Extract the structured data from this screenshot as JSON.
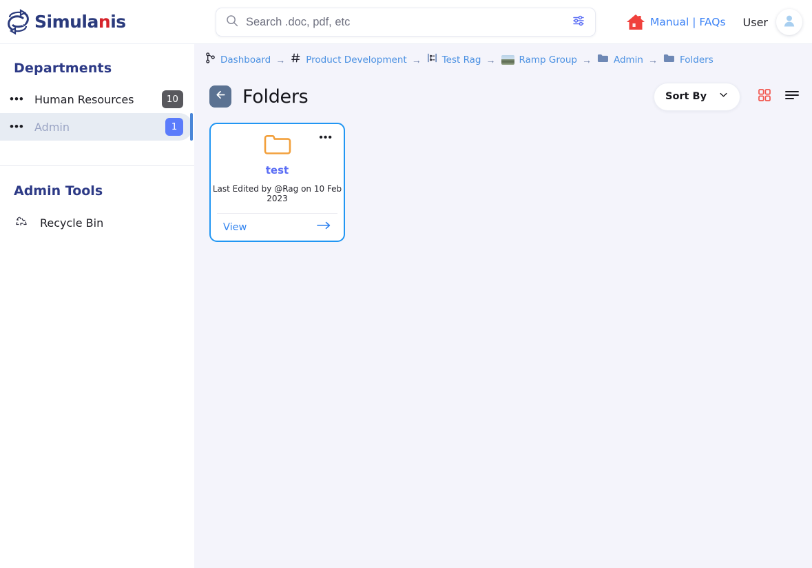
{
  "brand": {
    "name_prefix": "Simula",
    "name_accent": "n",
    "name_suffix": "is",
    "logo_icon": "simulanis-s-logo-icon",
    "primary_color": "#2a3a7c",
    "accent_color": "#d6232b"
  },
  "search": {
    "placeholder": "Search .doc, pdf, etc",
    "value": "",
    "search_icon": "search-icon",
    "filter_icon": "filter-sliders-icon"
  },
  "header": {
    "home_icon": "home-icon",
    "manual_label": "Manual",
    "separator": "|",
    "faqs_label": "FAQs",
    "user_label": "User",
    "avatar_icon": "user-avatar-icon",
    "link_color": "#3b82f6"
  },
  "sidebar": {
    "departments_title": "Departments",
    "departments": [
      {
        "label": "Human Resources",
        "badge": "10",
        "badge_color": "#58585d",
        "active": false,
        "menu_icon": "more-dots-icon"
      },
      {
        "label": "Admin",
        "badge": "1",
        "badge_color": "#5b7cfb",
        "active": true,
        "menu_icon": "more-dots-icon"
      }
    ],
    "tools_title": "Admin Tools",
    "tools": [
      {
        "label": "Recycle Bin",
        "icon": "recycle-bin-icon"
      }
    ]
  },
  "breadcrumb": {
    "arrow": "→",
    "items": [
      {
        "label": "Dashboard",
        "icon": "git-branch-icon"
      },
      {
        "label": "Product Development",
        "icon": "hash-icon"
      },
      {
        "label": "Test Rag",
        "icon": "list-tree-icon"
      },
      {
        "label": "Ramp Group",
        "icon": "image-thumbnail-icon"
      },
      {
        "label": "Admin",
        "icon": "folder-filled-icon"
      },
      {
        "label": "Folders",
        "icon": "folder-filled-icon"
      }
    ]
  },
  "page": {
    "back_icon": "back-arrow-icon",
    "title": "Folders",
    "sort_label": "Sort By",
    "sort_chevron_icon": "chevron-down-icon",
    "grid_view_icon": "grid-view-icon",
    "list_view_icon": "list-view-icon",
    "grid_view_color": "#f2554d"
  },
  "folders": [
    {
      "folder_icon": "folder-outline-icon",
      "menu_icon": "more-dots-icon",
      "name": "test",
      "meta": "Last Edited by @Rag on 10 Feb 2023",
      "action_label": "View",
      "action_icon": "arrow-right-icon",
      "border_color": "#2196f3",
      "icon_color": "#f2a03c"
    }
  ]
}
